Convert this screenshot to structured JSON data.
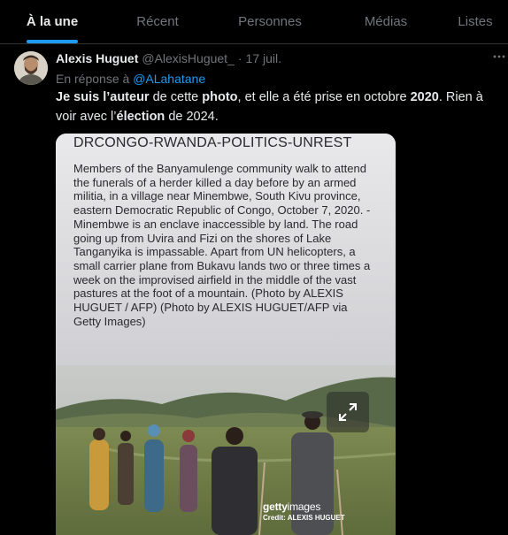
{
  "tabs": [
    {
      "label": "À la une",
      "active": true
    },
    {
      "label": "Récent",
      "active": false
    },
    {
      "label": "Personnes",
      "active": false
    },
    {
      "label": "Médias",
      "active": false
    },
    {
      "label": "Listes",
      "active": false
    }
  ],
  "tweet": {
    "author_name": "Alexis Huguet",
    "author_handle": "@AlexisHuguet_",
    "separator": "·",
    "date": "17 juil.",
    "reply_prefix": "En réponse à",
    "reply_mention": "@ALahatane",
    "text_parts": [
      {
        "t": "Je suis l’",
        "bold": true
      },
      {
        "t": "auteur",
        "bold": true
      },
      {
        "t": " de cette ",
        "bold": false
      },
      {
        "t": "photo",
        "bold": true
      },
      {
        "t": ", et elle a été prise en octobre ",
        "bold": false
      },
      {
        "t": "2020",
        "bold": true
      },
      {
        "t": ". Rien à voir avec l’",
        "bold": false
      },
      {
        "t": "élection",
        "bold": true
      },
      {
        "t": " de 2024.",
        "bold": false
      }
    ],
    "media": {
      "headline": "DRCONGO-RWANDA-POLITICS-UNREST",
      "caption": "Members of the Banyamulenge community walk to attend the funerals of a herder killed a day before by an armed militia, in a village near Minembwe, South Kivu province, eastern Democratic Republic of Congo, October 7, 2020. - Minembwe is an enclave inaccessible by land. The road going up from Uvira and Fizi on the shores of Lake Tanganyika is impassable. Apart from UN helicopters, a small carrier plane from Bukavu lands two or three times a week on the improvised airfield in the middle of the vast pastures at the foot of a mountain. (Photo by ALEXIS HUGUET / AFP) (Photo by ALEXIS HUGUET/AFP via Getty Images)",
      "watermark_logo_bold": "getty",
      "watermark_logo_light": "images",
      "watermark_credit": "Credit: ALEXIS HUGUET"
    }
  },
  "colors": {
    "background": "#000000",
    "accent": "#1d9bf0",
    "muted": "#71767b",
    "text": "#e7e9ea"
  },
  "icons": [
    "more-icon",
    "expand-icon"
  ]
}
